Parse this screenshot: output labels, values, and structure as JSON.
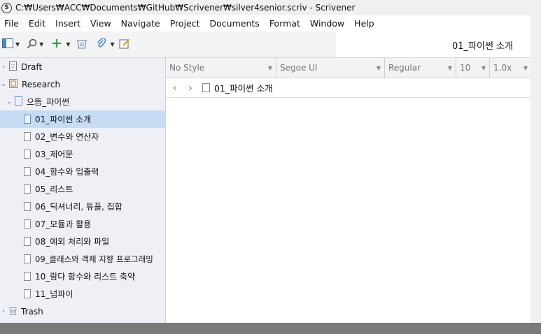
{
  "titlebar": {
    "icon_letter": "S",
    "title": "C:₩Users₩ACC₩Documents₩GitHub₩Scrivener₩silver4senior.scriv - Scrivener"
  },
  "menu": [
    "File",
    "Edit",
    "Insert",
    "View",
    "Navigate",
    "Project",
    "Documents",
    "Format",
    "Window",
    "Help"
  ],
  "toolbar": {
    "icons": [
      "binder-toggle-icon",
      "search-icon",
      "add-icon",
      "trash-icon",
      "attachment-icon",
      "compose-icon"
    ]
  },
  "document_title": "01_파이썬 소개",
  "format_bar": {
    "style": "No Style",
    "font": "Segoe UI",
    "weight": "Regular",
    "size": "10",
    "line_spacing": "1.0x"
  },
  "editor_header": {
    "title": "01_파이썬 소개"
  },
  "binder": {
    "draft": "Draft",
    "research": "Research",
    "folder": "으뜸_파이썬",
    "items": [
      "01_파이썬 소개",
      "02_변수와 연산자",
      "03_제어문",
      "04_함수와 입출력",
      "05_리스트",
      "06_딕셔너리, 튜플, 집합",
      "07_모듈과 활용",
      "08_예외 처리와 파일",
      "09_클래스와 객체 지향 프로그래밍",
      "10_람다 함수와 리스트 축약",
      "11_넘파이"
    ],
    "selected_index": 0,
    "trash": "Trash"
  },
  "colors": {
    "selection": "#c6dcf5",
    "binder_bg": "#eff0f5",
    "add_icon": "#2e9e4a",
    "attachment_icon": "#3a7ed0"
  }
}
